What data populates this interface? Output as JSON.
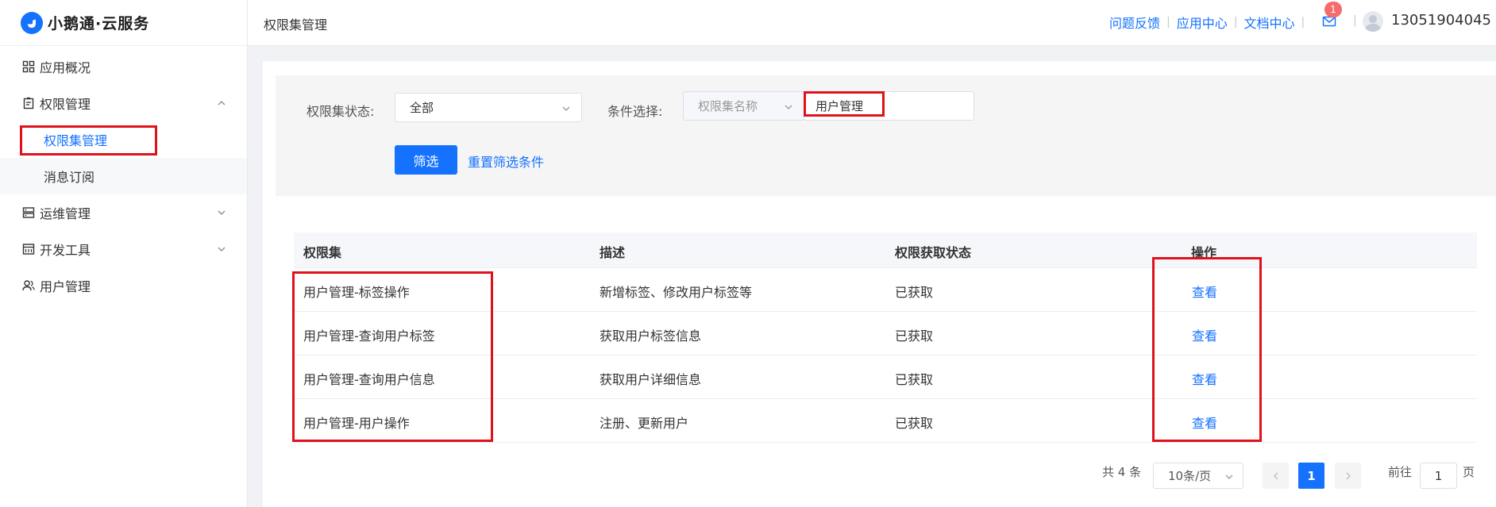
{
  "app": {
    "logo_text": "小鹅通·云服务"
  },
  "sidebar": {
    "items": [
      {
        "label": "应用概况",
        "icon": "grid-icon"
      },
      {
        "label": "权限管理",
        "icon": "clipboard-icon",
        "expanded": true
      },
      {
        "label": "权限集管理",
        "sub": true,
        "active": true
      },
      {
        "label": "消息订阅",
        "sub": true
      },
      {
        "label": "运维管理",
        "icon": "server-icon",
        "expanded": false
      },
      {
        "label": "开发工具",
        "icon": "code-window-icon",
        "expanded": false
      },
      {
        "label": "用户管理",
        "icon": "users-icon"
      }
    ]
  },
  "header": {
    "page_title": "权限集管理",
    "links": [
      "问题反馈",
      "应用中心",
      "文档中心"
    ],
    "notification_count": "1",
    "user_name": "13051904045"
  },
  "filter": {
    "status_label": "权限集状态:",
    "status_value": "全部",
    "condition_label": "条件选择:",
    "condition_field": "权限集名称",
    "condition_value": "用户管理",
    "submit_label": "筛选",
    "reset_label": "重置筛选条件"
  },
  "table": {
    "columns": [
      "权限集",
      "描述",
      "权限获取状态",
      "操作"
    ],
    "rows": [
      {
        "name": "用户管理-标签操作",
        "desc": "新增标签、修改用户标签等",
        "status": "已获取",
        "action": "查看"
      },
      {
        "name": "用户管理-查询用户标签",
        "desc": "获取用户标签信息",
        "status": "已获取",
        "action": "查看"
      },
      {
        "name": "用户管理-查询用户信息",
        "desc": "获取用户详细信息",
        "status": "已获取",
        "action": "查看"
      },
      {
        "name": "用户管理-用户操作",
        "desc": "注册、更新用户",
        "status": "已获取",
        "action": "查看"
      }
    ]
  },
  "pagination": {
    "total": "共 4 条",
    "page_size": "10条/页",
    "current_page": "1",
    "goto_label": "前往",
    "goto_value": "1",
    "page_suffix": "页"
  },
  "colors": {
    "accent": "#1472ff",
    "highlight": "#e0111a",
    "badge": "#f56c6c"
  }
}
